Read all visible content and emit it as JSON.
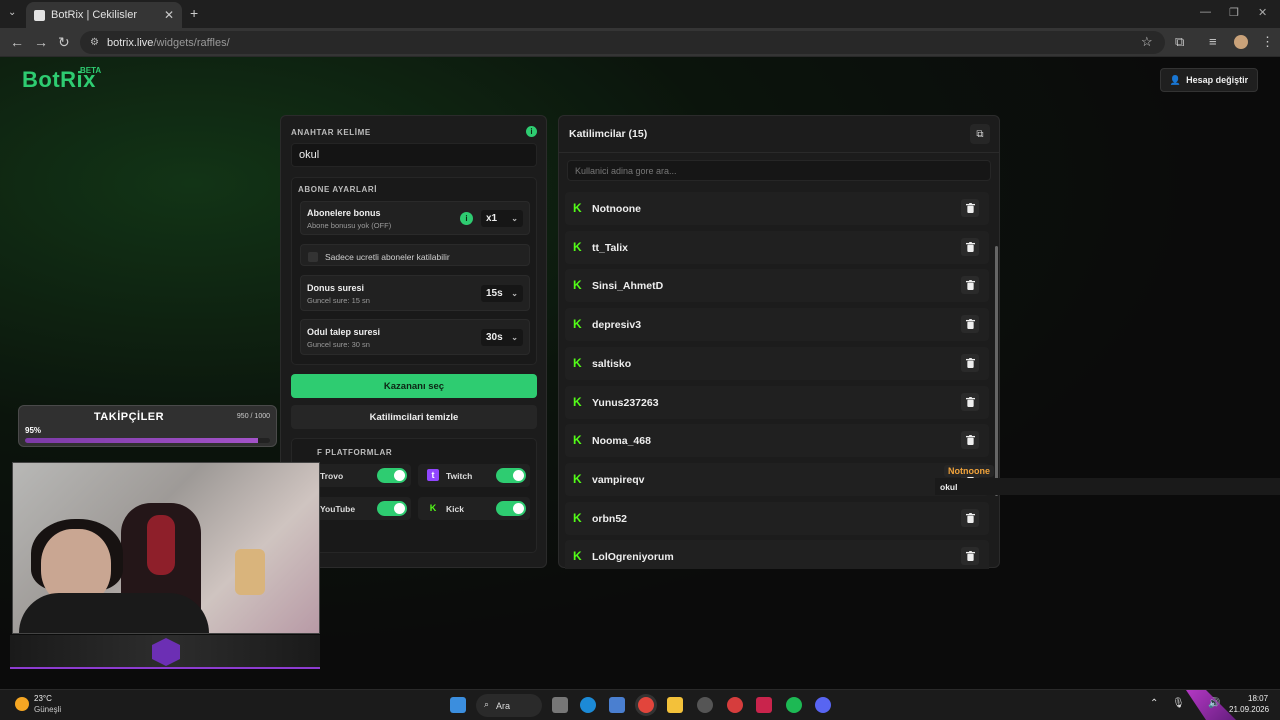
{
  "browser": {
    "tab_title": "BotRix | Cekilisler",
    "url_host": "botrix.live",
    "url_path": "/widgets/raffles/"
  },
  "header": {
    "brand": "BotRix",
    "beta": "BETA",
    "account_button": "Hesap değiştir"
  },
  "settings": {
    "keyword_label": "ANAHTAR KELİME",
    "keyword_value": "okul",
    "subscriber_section": "ABONE AYARLARİ",
    "sub_bonus_title": "Abonelere bonus",
    "sub_bonus_sub": "Abone bonusu yok (OFF)",
    "sub_bonus_value": "x1",
    "paid_only_label": "Sadece ucretli aboneler katilabilir",
    "duration_title": "Donus suresi",
    "duration_sub": "Guncel sure: 15 sn",
    "duration_value": "15s",
    "claim_title": "Odul talep suresi",
    "claim_sub": "Guncel sure: 30 sn",
    "claim_value": "30s",
    "pick_winner_button": "Kazananı seç",
    "clear_participants_button": "Katilimcilari temizle",
    "platforms_label": "F PLATFORMLAR",
    "platforms": [
      {
        "name": "Trovo",
        "enabled": true
      },
      {
        "name": "Twitch",
        "enabled": true
      },
      {
        "name": "YouTube",
        "enabled": true
      },
      {
        "name": "Kick",
        "enabled": true
      }
    ]
  },
  "participants": {
    "header": "Katilimcilar (15)",
    "search_placeholder": "Kullanici adina gore ara...",
    "items": [
      "Notnoone",
      "tt_Talix",
      "Sinsi_AhmetD",
      "depresiv3",
      "saltisko",
      "Yunus237263",
      "Nooma_468",
      "vampireqv",
      "orbn52",
      "LolOgreniyorum"
    ],
    "tooltip_name": "Notnoone",
    "tooltip_value": "okul"
  },
  "overlay": {
    "followers_title": "TAKİPÇİLER",
    "followers_count": "950 / 1000",
    "followers_percent": "95%",
    "followers_progress": 0.95
  },
  "taskbar": {
    "weather_temp": "23°C",
    "weather_desc": "Güneşli",
    "search_label": "Ara",
    "time": "18:07",
    "date": "21.09.2026"
  },
  "colors": {
    "accent": "#2ecc71",
    "kick": "#53fc18",
    "twitch": "#9146ff",
    "progress": "#a353c9",
    "tooltip_name": "#f0a23a"
  }
}
